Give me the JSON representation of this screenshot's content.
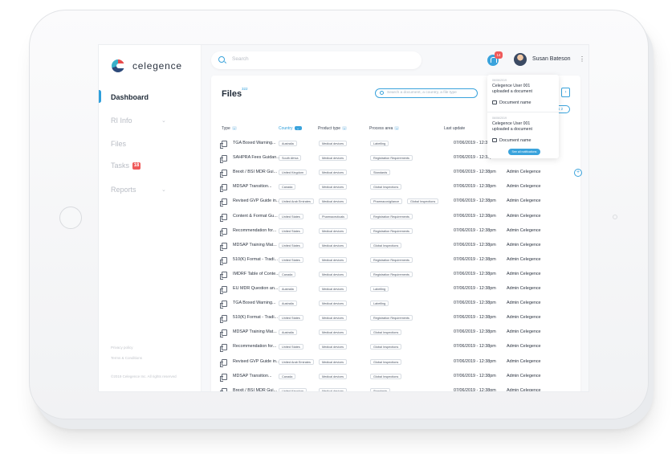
{
  "brand": {
    "name": "celegence"
  },
  "sidebar": {
    "items": [
      {
        "label": "Dashboard",
        "active": true
      },
      {
        "label": "RI Info",
        "chevron": true
      },
      {
        "label": "Files"
      },
      {
        "label": "Tasks",
        "badge": "18"
      },
      {
        "label": "Reports",
        "chevron": true
      }
    ],
    "footer": {
      "privacy": "Privacy policy",
      "terms": "Terms & Conditions",
      "copyright": "©2019 Celegence Inc. All rights reserved"
    }
  },
  "header": {
    "search_placeholder": "Search",
    "notifications_badge": "14",
    "user_name": "Susan Bateson"
  },
  "files": {
    "title": "Files",
    "count": "322",
    "search_placeholder": "Search a document, a country, a file type",
    "columns": [
      "Type",
      "Country",
      "Product type",
      "Process area",
      "Last update"
    ],
    "rows": [
      {
        "name": "TGA Boxed Warning...",
        "country": "Australia",
        "product": "Medical devices",
        "process": [
          "Labelling"
        ],
        "date": "07/06/2019 - 12:38pm",
        "by": ""
      },
      {
        "name": "SAHPRA Fees Guidan...",
        "country": "South Africa",
        "product": "Medical devices",
        "process": [
          "Registration Requirements"
        ],
        "date": "07/06/2019 - 12:38pm",
        "by": ""
      },
      {
        "name": "Brexit / BSI MDR Gui...",
        "country": "United Kingdom",
        "product": "Medical devices",
        "process": [
          "Standards"
        ],
        "date": "07/06/2019 - 12:38pm",
        "by": "Admin Celegence"
      },
      {
        "name": "MDSAP Transition...",
        "country": "Canada",
        "product": "Medical devices",
        "process": [
          "Global Inspections"
        ],
        "date": "07/06/2019 - 12:38pm",
        "by": "Admin Celegence"
      },
      {
        "name": "Revised GVP Guide in...",
        "country": "United Arab Emirates",
        "product": "Medical devices",
        "process": [
          "Pharmacovigilance",
          "Global Inspections"
        ],
        "date": "07/06/2019 - 12:38pm",
        "by": "Admin Celegence"
      },
      {
        "name": "Content & Format Gu...",
        "country": "United States",
        "product": "Pharmaceuticals",
        "process": [
          "Registration Requirements"
        ],
        "date": "07/06/2019 - 12:38pm",
        "by": "Admin Celegence"
      },
      {
        "name": "Recommendation for...",
        "country": "United States",
        "product": "Medical devices",
        "process": [
          "Registration Requirements"
        ],
        "date": "07/06/2019 - 12:38pm",
        "by": "Admin Celegence"
      },
      {
        "name": "MDSAP Training Mat...",
        "country": "United States",
        "product": "Medical devices",
        "process": [
          "Global Inspections"
        ],
        "date": "07/06/2019 - 12:38pm",
        "by": "Admin Celegence"
      },
      {
        "name": "510(K) Format - Tradi...",
        "country": "United States",
        "product": "Medical devices",
        "process": [
          "Registration Requirements"
        ],
        "date": "07/06/2019 - 12:38pm",
        "by": "Admin Celegence"
      },
      {
        "name": "IMDRF Table of Conte...",
        "country": "Canada",
        "product": "Medical devices",
        "process": [
          "Registration Requirements"
        ],
        "date": "07/06/2019 - 12:38pm",
        "by": "Admin Celegence"
      },
      {
        "name": "EU MDR Question an...",
        "country": "Australia",
        "product": "Medical devices",
        "process": [
          "Labelling"
        ],
        "date": "07/06/2019 - 12:38pm",
        "by": "Admin Celegence"
      },
      {
        "name": "TGA Boxed Warning...",
        "country": "Australia",
        "product": "Medical devices",
        "process": [
          "Labelling"
        ],
        "date": "07/06/2019 - 12:38pm",
        "by": "Admin Celegence"
      },
      {
        "name": "510(K) Format - Tradi...",
        "country": "United States",
        "product": "Medical devices",
        "process": [
          "Registration Requirements"
        ],
        "date": "07/06/2019 - 12:38pm",
        "by": "Admin Celegence"
      },
      {
        "name": "MDSAP Training Mat...",
        "country": "Australia",
        "product": "Medical devices",
        "process": [
          "Global Inspections"
        ],
        "date": "07/06/2019 - 12:38pm",
        "by": "Admin Celegence"
      },
      {
        "name": "Recommendation for...",
        "country": "United States",
        "product": "Medical devices",
        "process": [
          "Global Inspections"
        ],
        "date": "07/06/2019 - 12:38pm",
        "by": "Admin Celegence"
      },
      {
        "name": "Revised GVP Guide in...",
        "country": "United Arab Emirates",
        "product": "Medical devices",
        "process": [
          "Global Inspections"
        ],
        "date": "07/06/2019 - 12:38pm",
        "by": "Admin Celegence"
      },
      {
        "name": "MDSAP Transition...",
        "country": "Canada",
        "product": "Medical devices",
        "process": [
          "Global Inspections"
        ],
        "date": "07/06/2019 - 12:38pm",
        "by": "Admin Celegence"
      },
      {
        "name": "Brexit / BSI MDR Gui...",
        "country": "United Kingdom",
        "product": "Medical devices",
        "process": [
          "Standards"
        ],
        "date": "07/06/2019 - 12:38pm",
        "by": "Admin Celegence"
      }
    ]
  },
  "notifications": [
    {
      "date": "06/06/2019",
      "text_line1": "Celegence User 001",
      "text_line2": "uploaded a document",
      "doc": "Document name"
    },
    {
      "date": "06/06/2019",
      "text_line1": "Celegence User 001",
      "text_line2": "uploaded a document",
      "doc": "Document name"
    }
  ],
  "notifications_button": "See all notifications",
  "colors": {
    "accent": "#3aa3dc",
    "badge": "#ef5a5a",
    "text": "#2b3340"
  }
}
